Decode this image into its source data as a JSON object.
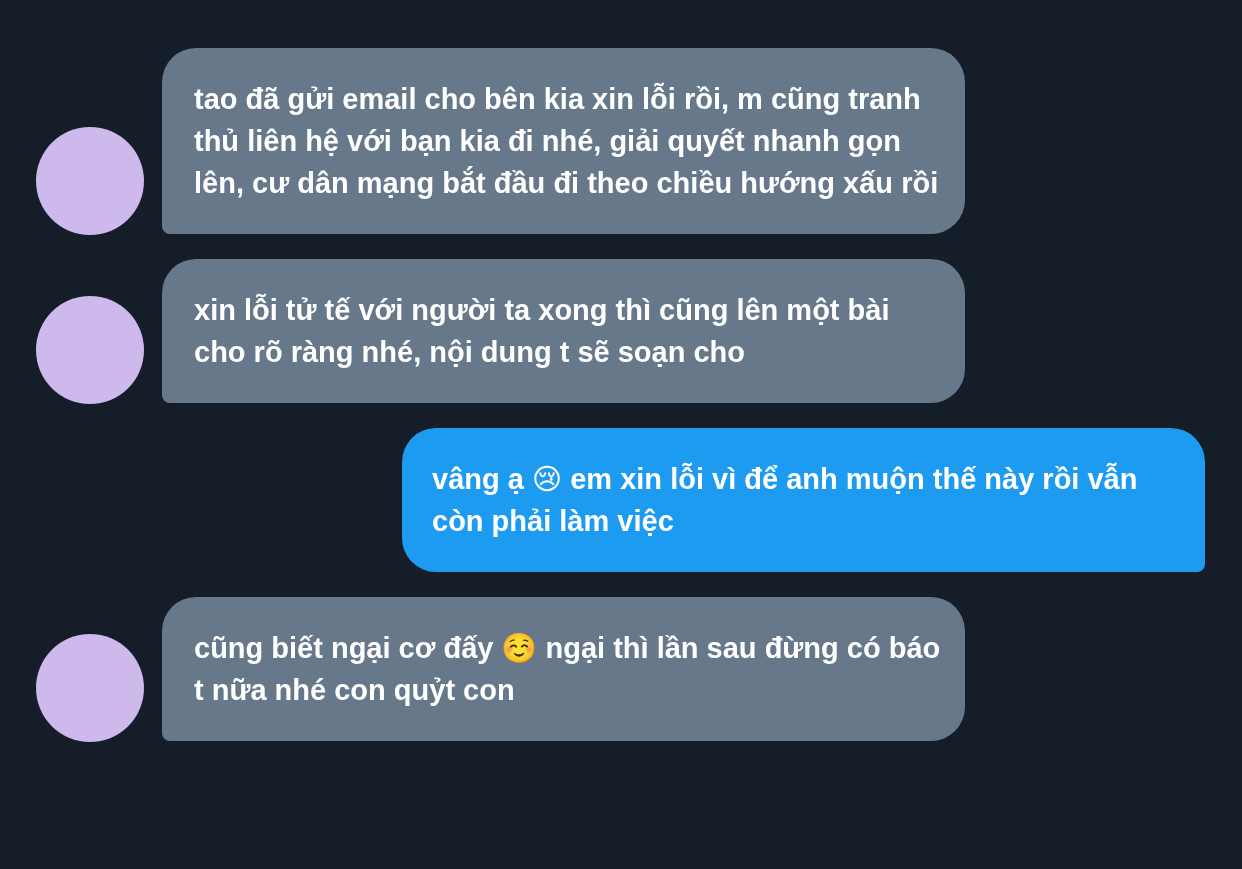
{
  "messages": [
    {
      "kind": "incoming",
      "text": "tao đã gửi email cho bên kia xin lỗi rồi, m cũng tranh thủ liên hệ với bạn kia đi nhé, giải quyết nhanh gọn lên, cư dân mạng bắt đầu đi theo chiều hướng xấu rồi"
    },
    {
      "kind": "incoming",
      "text": "xin lỗi tử tế với người ta xong thì cũng lên một bài cho rõ ràng nhé, nội dung t sẽ soạn cho"
    },
    {
      "kind": "outgoing",
      "text": "vâng ạ 😢 em xin lỗi vì để anh muộn thế này rồi vẫn còn phải làm việc"
    },
    {
      "kind": "incoming",
      "text": "cũng biết ngại cơ đấy ☺️ ngại thì lần sau đừng có báo t nữa nhé con quỷt con"
    }
  ]
}
